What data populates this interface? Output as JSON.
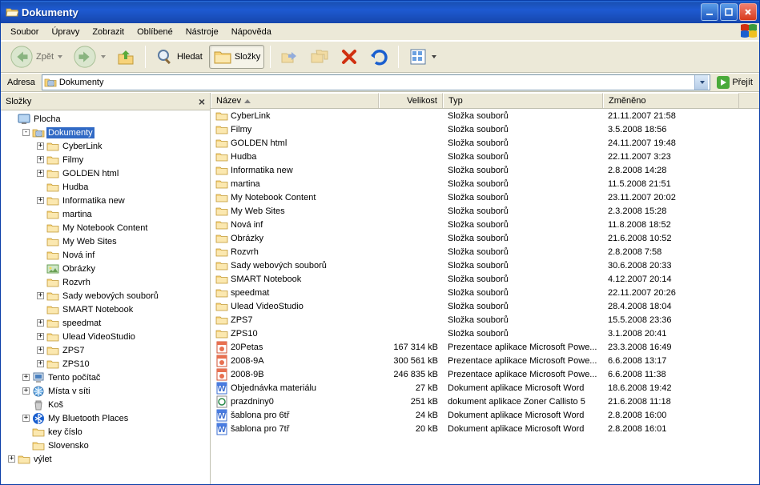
{
  "window_title": "Dokumenty",
  "menu": {
    "items": [
      "Soubor",
      "Úpravy",
      "Zobrazit",
      "Oblíbené",
      "Nástroje",
      "Nápověda"
    ]
  },
  "toolbar": {
    "back": "Zpět",
    "search": "Hledat",
    "folders": "Složky"
  },
  "address": {
    "label": "Adresa",
    "value": "Dokumenty",
    "go": "Přejít"
  },
  "tree_header": "Složky",
  "tree": [
    {
      "indent": 0,
      "expander": "",
      "icon": "desktop",
      "label": "Plocha"
    },
    {
      "indent": 1,
      "expander": "-",
      "icon": "mydocs",
      "label": "Dokumenty",
      "selected": true
    },
    {
      "indent": 2,
      "expander": "+",
      "icon": "folder",
      "label": "CyberLink"
    },
    {
      "indent": 2,
      "expander": "+",
      "icon": "folder",
      "label": "Filmy"
    },
    {
      "indent": 2,
      "expander": "+",
      "icon": "folder",
      "label": "GOLDEN html"
    },
    {
      "indent": 2,
      "expander": "",
      "icon": "folder",
      "label": "Hudba"
    },
    {
      "indent": 2,
      "expander": "+",
      "icon": "folder",
      "label": "Informatika new"
    },
    {
      "indent": 2,
      "expander": "",
      "icon": "folder",
      "label": "martina"
    },
    {
      "indent": 2,
      "expander": "",
      "icon": "folder",
      "label": "My Notebook Content"
    },
    {
      "indent": 2,
      "expander": "",
      "icon": "folder",
      "label": "My Web Sites"
    },
    {
      "indent": 2,
      "expander": "",
      "icon": "folder",
      "label": "Nová inf"
    },
    {
      "indent": 2,
      "expander": "",
      "icon": "pictures",
      "label": "Obrázky"
    },
    {
      "indent": 2,
      "expander": "",
      "icon": "folder",
      "label": "Rozvrh"
    },
    {
      "indent": 2,
      "expander": "+",
      "icon": "folder",
      "label": "Sady webových souborů"
    },
    {
      "indent": 2,
      "expander": "",
      "icon": "folder",
      "label": "SMART Notebook"
    },
    {
      "indent": 2,
      "expander": "+",
      "icon": "folder",
      "label": "speedmat"
    },
    {
      "indent": 2,
      "expander": "+",
      "icon": "folder",
      "label": "Ulead VideoStudio"
    },
    {
      "indent": 2,
      "expander": "+",
      "icon": "folder",
      "label": "ZPS7"
    },
    {
      "indent": 2,
      "expander": "+",
      "icon": "folder",
      "label": "ZPS10"
    },
    {
      "indent": 1,
      "expander": "+",
      "icon": "computer",
      "label": "Tento počítač"
    },
    {
      "indent": 1,
      "expander": "+",
      "icon": "network",
      "label": "Místa v síti"
    },
    {
      "indent": 1,
      "expander": "",
      "icon": "recycle",
      "label": "Koš"
    },
    {
      "indent": 1,
      "expander": "+",
      "icon": "bluetooth",
      "label": "My Bluetooth Places"
    },
    {
      "indent": 1,
      "expander": "",
      "icon": "folder",
      "label": "key číslo"
    },
    {
      "indent": 1,
      "expander": "",
      "icon": "folder",
      "label": "Slovensko"
    },
    {
      "indent": 0,
      "expander": "+",
      "icon": "folder",
      "label": "výlet"
    }
  ],
  "columns": {
    "name": "Název",
    "size": "Velikost",
    "type": "Typ",
    "modified": "Změněno"
  },
  "col_widths": {
    "name": 210,
    "size": 80,
    "type": 200,
    "modified": 170
  },
  "files": [
    {
      "icon": "folder",
      "name": "CyberLink",
      "size": "",
      "type": "Složka souborů",
      "modified": "21.11.2007 21:58"
    },
    {
      "icon": "folder",
      "name": "Filmy",
      "size": "",
      "type": "Složka souborů",
      "modified": "3.5.2008 18:56"
    },
    {
      "icon": "folder",
      "name": "GOLDEN html",
      "size": "",
      "type": "Složka souborů",
      "modified": "24.11.2007 19:48"
    },
    {
      "icon": "folder",
      "name": "Hudba",
      "size": "",
      "type": "Složka souborů",
      "modified": "22.11.2007 3:23"
    },
    {
      "icon": "folder",
      "name": "Informatika new",
      "size": "",
      "type": "Složka souborů",
      "modified": "2.8.2008 14:28"
    },
    {
      "icon": "folder",
      "name": "martina",
      "size": "",
      "type": "Složka souborů",
      "modified": "11.5.2008 21:51"
    },
    {
      "icon": "folder",
      "name": "My Notebook Content",
      "size": "",
      "type": "Složka souborů",
      "modified": "23.11.2007 20:02"
    },
    {
      "icon": "folder",
      "name": "My Web Sites",
      "size": "",
      "type": "Složka souborů",
      "modified": "2.3.2008 15:28"
    },
    {
      "icon": "folder",
      "name": "Nová inf",
      "size": "",
      "type": "Složka souborů",
      "modified": "11.8.2008 18:52"
    },
    {
      "icon": "folder",
      "name": "Obrázky",
      "size": "",
      "type": "Složka souborů",
      "modified": "21.6.2008 10:52"
    },
    {
      "icon": "folder",
      "name": "Rozvrh",
      "size": "",
      "type": "Složka souborů",
      "modified": "2.8.2008 7:58"
    },
    {
      "icon": "folder",
      "name": "Sady webových souborů",
      "size": "",
      "type": "Složka souborů",
      "modified": "30.6.2008 20:33"
    },
    {
      "icon": "folder",
      "name": "SMART Notebook",
      "size": "",
      "type": "Složka souborů",
      "modified": "4.12.2007 20:14"
    },
    {
      "icon": "folder",
      "name": "speedmat",
      "size": "",
      "type": "Složka souborů",
      "modified": "22.11.2007 20:26"
    },
    {
      "icon": "folder",
      "name": "Ulead VideoStudio",
      "size": "",
      "type": "Složka souborů",
      "modified": "28.4.2008 18:04"
    },
    {
      "icon": "folder",
      "name": "ZPS7",
      "size": "",
      "type": "Složka souborů",
      "modified": "15.5.2008 23:36"
    },
    {
      "icon": "folder",
      "name": "ZPS10",
      "size": "",
      "type": "Složka souborů",
      "modified": "3.1.2008 20:41"
    },
    {
      "icon": "ppt",
      "name": "20Petas",
      "size": "167 314 kB",
      "type": "Prezentace aplikace Microsoft Powe...",
      "modified": "23.3.2008 16:49"
    },
    {
      "icon": "ppt",
      "name": "2008-9A",
      "size": "300 561 kB",
      "type": "Prezentace aplikace Microsoft Powe...",
      "modified": "6.6.2008 13:17"
    },
    {
      "icon": "ppt",
      "name": "2008-9B",
      "size": "246 835 kB",
      "type": "Prezentace aplikace Microsoft Powe...",
      "modified": "6.6.2008 11:38"
    },
    {
      "icon": "word",
      "name": "Objednávka materiálu",
      "size": "27 kB",
      "type": "Dokument aplikace Microsoft Word",
      "modified": "18.6.2008 19:42"
    },
    {
      "icon": "zoner",
      "name": "prazdniny0",
      "size": "251 kB",
      "type": "dokument aplikace Zoner Callisto 5",
      "modified": "21.6.2008 11:18"
    },
    {
      "icon": "word",
      "name": "šablona pro 6tř",
      "size": "24 kB",
      "type": "Dokument aplikace Microsoft Word",
      "modified": "2.8.2008 16:00"
    },
    {
      "icon": "word",
      "name": "šablona pro 7tř",
      "size": "20 kB",
      "type": "Dokument aplikace Microsoft Word",
      "modified": "2.8.2008 16:01"
    }
  ]
}
